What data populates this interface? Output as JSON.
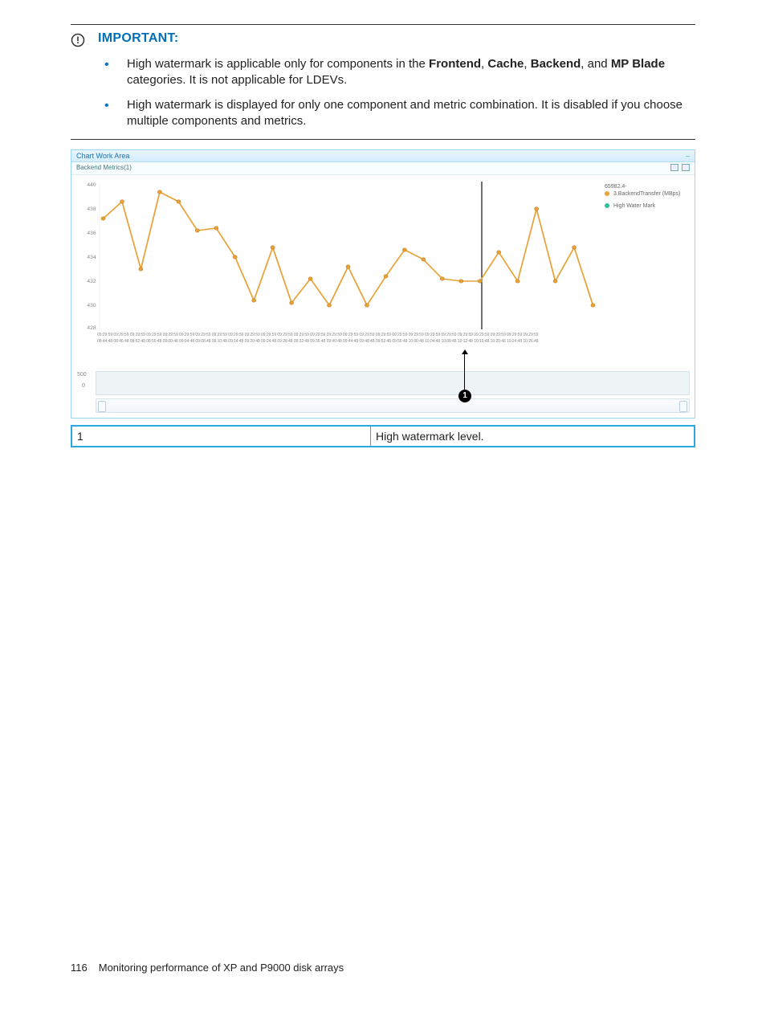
{
  "important": {
    "label": "IMPORTANT:",
    "bullet1_pre": "High watermark is applicable only for components in the ",
    "bullet1_b1": "Frontend",
    "bullet1_sep1": ", ",
    "bullet1_b2": "Cache",
    "bullet1_sep2": ", ",
    "bullet1_b3": "Backend",
    "bullet1_sep3": ", and ",
    "bullet1_b4": "MP Blade",
    "bullet1_post": " categories. It is not applicable for LDEVs.",
    "bullet2": "High watermark is displayed for only one component and metric combination. It is disabled if you choose multiple components and metrics."
  },
  "figure": {
    "titlebar": "Chart Work Area",
    "subtitle": "Backend Metrics(1)",
    "legend_series_title": "65982.4-",
    "legend_series_line": "3.BackendTransfer (MBps)",
    "legend_hwm": "High Water Mark",
    "callout_num": "1",
    "lower_strip_top": "500",
    "lower_strip_bot": "0"
  },
  "key_table": {
    "k1": "1",
    "v1": "High watermark level."
  },
  "footer": {
    "page": "116",
    "chapter": "Monitoring performance of XP and P9000 disk arrays"
  },
  "chart_data": {
    "type": "line",
    "title": "Backend Metrics(1)",
    "xlabel": "",
    "ylabel": "",
    "ylim": [
      428,
      440
    ],
    "y_ticks": [
      428,
      430,
      432,
      434,
      436,
      438,
      440
    ],
    "series": [
      {
        "name": "65982.4-3.BackendTransfer (MBps)",
        "color": "#e8a33b",
        "x": [
          "08:44:48",
          "08:46:48",
          "08:52:48",
          "08:56:48",
          "09:00:48",
          "09:04:48",
          "09:08:48",
          "09:10:48",
          "09:14:48",
          "09:20:48",
          "09:24:48",
          "09:28:48",
          "09:32:48",
          "09:36:48",
          "09:40:48",
          "09:44:48",
          "09:48:48",
          "09:52:48",
          "09:56:48",
          "10:00:48",
          "10:04:48",
          "10:08:48",
          "10:12:48",
          "10:16:48",
          "10:20:48",
          "10:24:48",
          "10:26:48"
        ],
        "values": [
          437.2,
          438.6,
          433.0,
          439.4,
          438.6,
          436.2,
          436.4,
          434.0,
          430.4,
          434.8,
          430.2,
          432.2,
          430.0,
          433.2,
          430.0,
          432.4,
          434.6,
          433.8,
          432.2,
          432.0,
          432.0,
          434.4,
          432.0,
          438.0,
          432.0,
          434.8,
          430.0
        ]
      }
    ],
    "x_tick_top": "09:29:59",
    "high_water_mark_x": "10:06:00",
    "annotations": [
      {
        "text": "1",
        "meaning": "High watermark level."
      }
    ]
  }
}
